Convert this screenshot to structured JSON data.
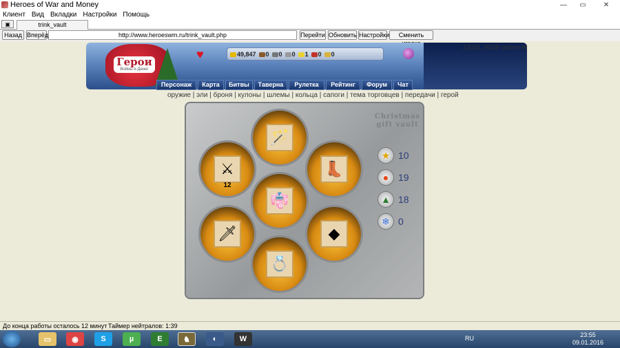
{
  "window": {
    "title": "Heroes of War and Money"
  },
  "menu": [
    "Клиент",
    "Вид",
    "Вкладки",
    "Настройки",
    "Помощь"
  ],
  "tab": {
    "label": "trink_vault"
  },
  "address": {
    "back": "Назад",
    "forward": "Вперёд",
    "url": "http://www.heroeswm.ru/trink_vault.php",
    "go": "Перейти",
    "refresh": "Обновить",
    "settings": "Настройки",
    "switch_player": "Сменить игрока"
  },
  "banner": {
    "logo": "Герои",
    "logo_sub": "Войны и Денег",
    "resources": [
      "49,847",
      "0",
      "0",
      "0",
      "1",
      "0",
      "0"
    ],
    "status": "23:55, 9039 online"
  },
  "nav": [
    "Персонаж",
    "Карта",
    "Битвы",
    "Таверна",
    "Рулетка",
    "Рейтинг",
    "Форум",
    "Чат"
  ],
  "categories": [
    "оружие",
    "эли",
    "броня",
    "кулоны",
    "шлемы",
    "кольца",
    "сапоги",
    "тема торговцев",
    "передачи",
    "герой"
  ],
  "vault": {
    "title": "Christmas gift vault",
    "chests": [
      {
        "item": "staff",
        "count": ""
      },
      {
        "item": "swords",
        "count": "12"
      },
      {
        "item": "boots",
        "count": ""
      },
      {
        "item": "armor",
        "count": ""
      },
      {
        "item": "sword",
        "count": ""
      },
      {
        "item": "cape",
        "count": ""
      },
      {
        "item": "ring",
        "count": ""
      }
    ],
    "counters": [
      {
        "icon": "star-icon",
        "value": "10"
      },
      {
        "icon": "lantern-icon",
        "value": "19"
      },
      {
        "icon": "tree-icon",
        "value": "18"
      },
      {
        "icon": "snowflake-icon",
        "value": "0"
      }
    ]
  },
  "status": {
    "left": "До конца работы осталось 12 минут",
    "right": "Таймер нейтралов: 1:39"
  },
  "tray": {
    "lang": "RU",
    "time": "23:55",
    "date": "09.01.2016"
  }
}
